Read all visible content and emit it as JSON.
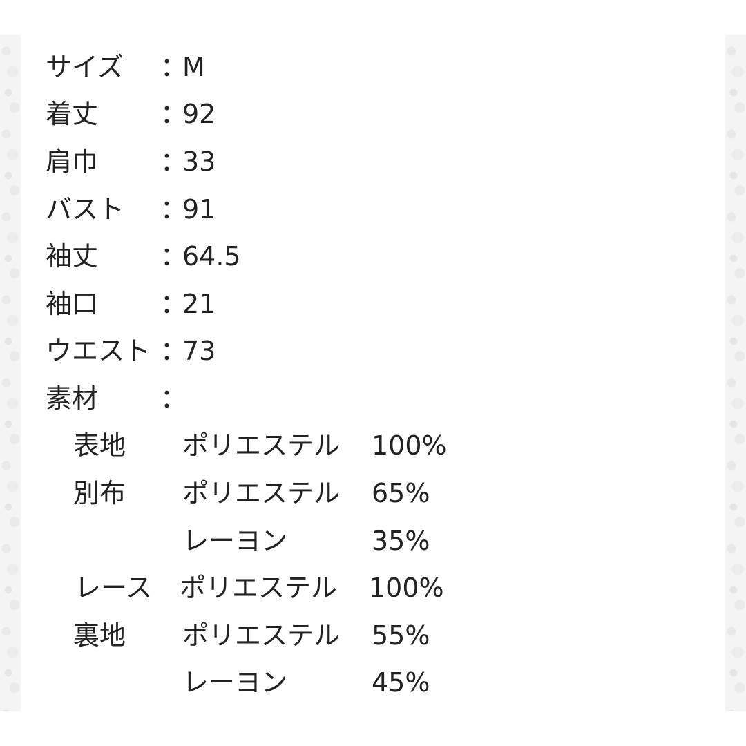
{
  "specs": [
    {
      "label": "サイズ",
      "colon": "：",
      "value": "M"
    },
    {
      "label": "着丈",
      "colon": "：",
      "value": "92"
    },
    {
      "label": "肩巾",
      "colon": "：",
      "value": "33"
    },
    {
      "label": "バスト",
      "colon": "：",
      "value": "91"
    },
    {
      "label": "袖丈",
      "colon": "：",
      "value": "64.5"
    },
    {
      "label": "袖口",
      "colon": "：",
      "value": "21"
    },
    {
      "label": "ウエスト",
      "colon": "：",
      "value": "73"
    },
    {
      "label": "素材",
      "colon": "：",
      "value": ""
    }
  ],
  "materials": [
    {
      "part": "表地",
      "fiber": "ポリエステル",
      "percent": "100%"
    },
    {
      "part": "別布",
      "fiber": "ポリエステル",
      "percent": "65%"
    },
    {
      "part": "",
      "fiber": "レーヨン",
      "percent": "35%"
    },
    {
      "part": "レース",
      "fiber": "ポリエステル",
      "percent": "100%"
    },
    {
      "part": "裏地",
      "fiber": "ポリエステル",
      "percent": "55%"
    },
    {
      "part": "",
      "fiber": "レーヨン",
      "percent": "45%"
    }
  ]
}
